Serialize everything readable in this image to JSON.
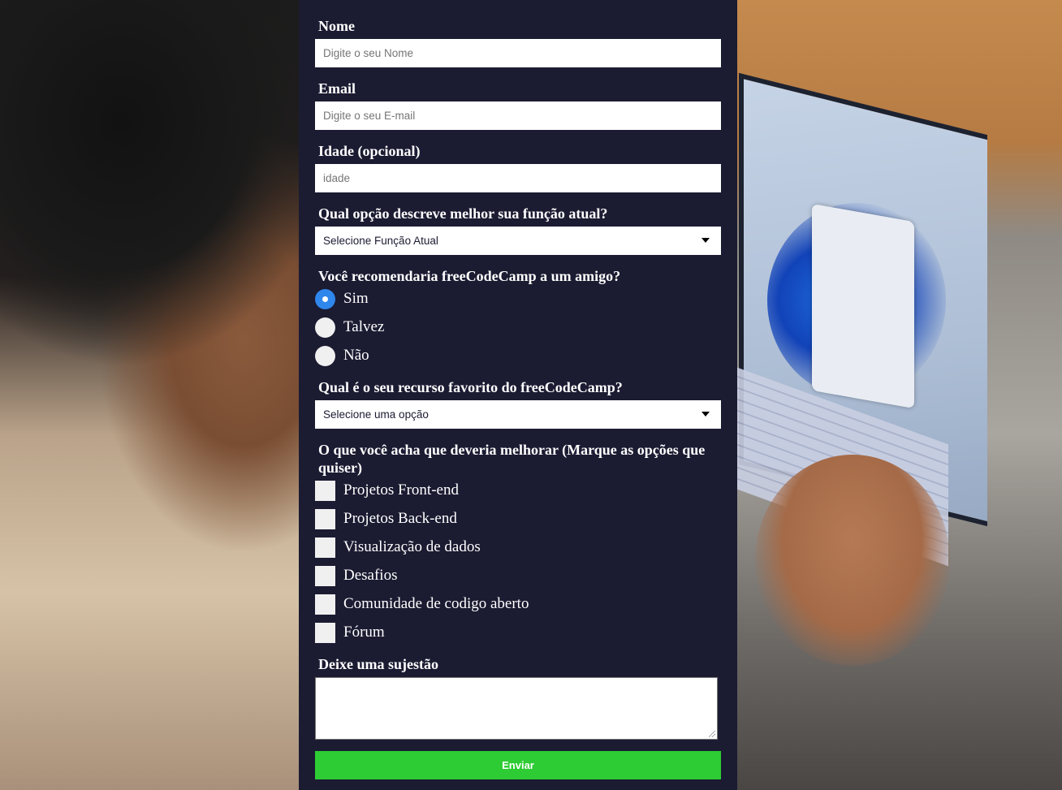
{
  "form": {
    "name": {
      "label": "Nome",
      "placeholder": "Digite o seu Nome"
    },
    "email": {
      "label": "Email",
      "placeholder": "Digite o seu E-mail"
    },
    "age": {
      "label": "Idade (opcional)",
      "placeholder": "idade"
    },
    "role": {
      "label": "Qual opção descreve melhor sua função atual?",
      "selected": "Selecione Função Atual"
    },
    "recommend": {
      "label": "Você recomendaria freeCodeCamp a um amigo?",
      "options": [
        "Sim",
        "Talvez",
        "Não"
      ],
      "selected": "Sim"
    },
    "favorite": {
      "label": "Qual é o seu recurso favorito do freeCodeCamp?",
      "selected": "Selecione uma opção"
    },
    "improve": {
      "label": "O que você acha que deveria melhorar (Marque as opções que quiser)",
      "options": [
        "Projetos Front-end",
        "Projetos Back-end",
        "Visualização de dados",
        "Desafios",
        "Comunidade de codigo aberto",
        "Fórum"
      ]
    },
    "suggestion": {
      "label": "Deixe uma sujestão"
    },
    "submit_label": "Enviar"
  },
  "colors": {
    "panel": "#1b1b32",
    "submit": "#2ecc34",
    "radio_selected": "#2f86eb"
  }
}
